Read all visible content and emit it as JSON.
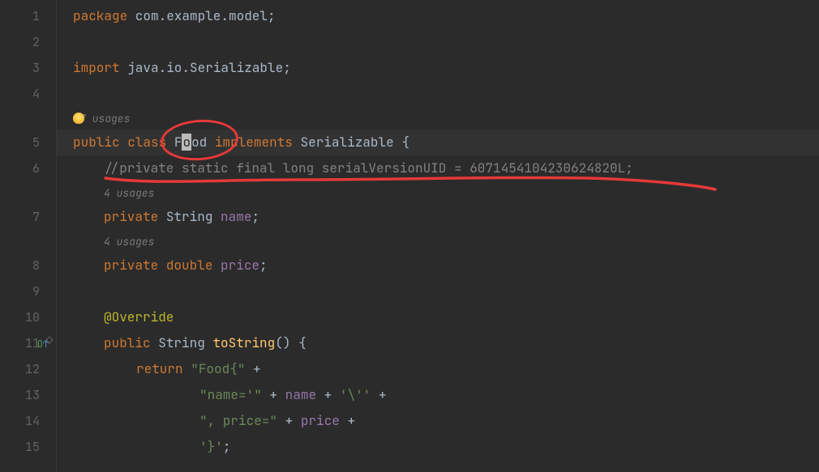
{
  "lines": {
    "l1": {
      "kw": "package",
      "pkg": " com.example.model",
      "sc": ";"
    },
    "l3": {
      "kw": "import",
      "pkg": " java.io.Serializable",
      "sc": ";"
    },
    "usages5": "7 usages",
    "l5": {
      "kw1": "public",
      "sp1": " ",
      "kw2": "class",
      "sp2": " ",
      "cls_a": "F",
      "cls_sel": "o",
      "cls_b": "od",
      "sp3": " ",
      "kw3": "implements",
      "sp4": " ",
      "iface": "Serializable",
      "sp5": " ",
      "brace": "{"
    },
    "l6": "//private static final long serialVersionUID = 6071454104230624820L;",
    "usages7": "4 usages",
    "l7": {
      "kw": "private",
      "sp1": " ",
      "type": "String",
      "sp2": " ",
      "id": "name",
      "sc": ";"
    },
    "usages8": "4 usages",
    "l8": {
      "kw": "private",
      "sp1": " ",
      "type": "double",
      "sp2": " ",
      "id": "price",
      "sc": ";"
    },
    "l10": "@Override",
    "l11": {
      "kw": "public",
      "sp1": " ",
      "type": "String",
      "sp2": " ",
      "fn": "toString",
      "paren": "()",
      "sp3": " ",
      "brace": "{"
    },
    "l12": {
      "kw": "return",
      "sp": " ",
      "str": "\"Food{\"",
      "sp2": " ",
      "op": "+"
    },
    "l13": {
      "str1": "\"name='\"",
      "sp1": " ",
      "op1": "+",
      "sp2": " ",
      "id": "name",
      "sp3": " ",
      "op2": "+",
      "sp4": " ",
      "str2": "'\\''",
      "sp5": " ",
      "op3": "+"
    },
    "l14": {
      "str": "\", price=\"",
      "sp1": " ",
      "op1": "+",
      "sp2": " ",
      "id": "price",
      "sp3": " ",
      "op2": "+"
    },
    "l15": {
      "str": "'}'",
      "sc": ";"
    }
  },
  "lineNumbers": [
    "1",
    "2",
    "3",
    "4",
    "5",
    "6",
    "7",
    "8",
    "9",
    "10",
    "11",
    "12",
    "13",
    "14",
    "15"
  ]
}
